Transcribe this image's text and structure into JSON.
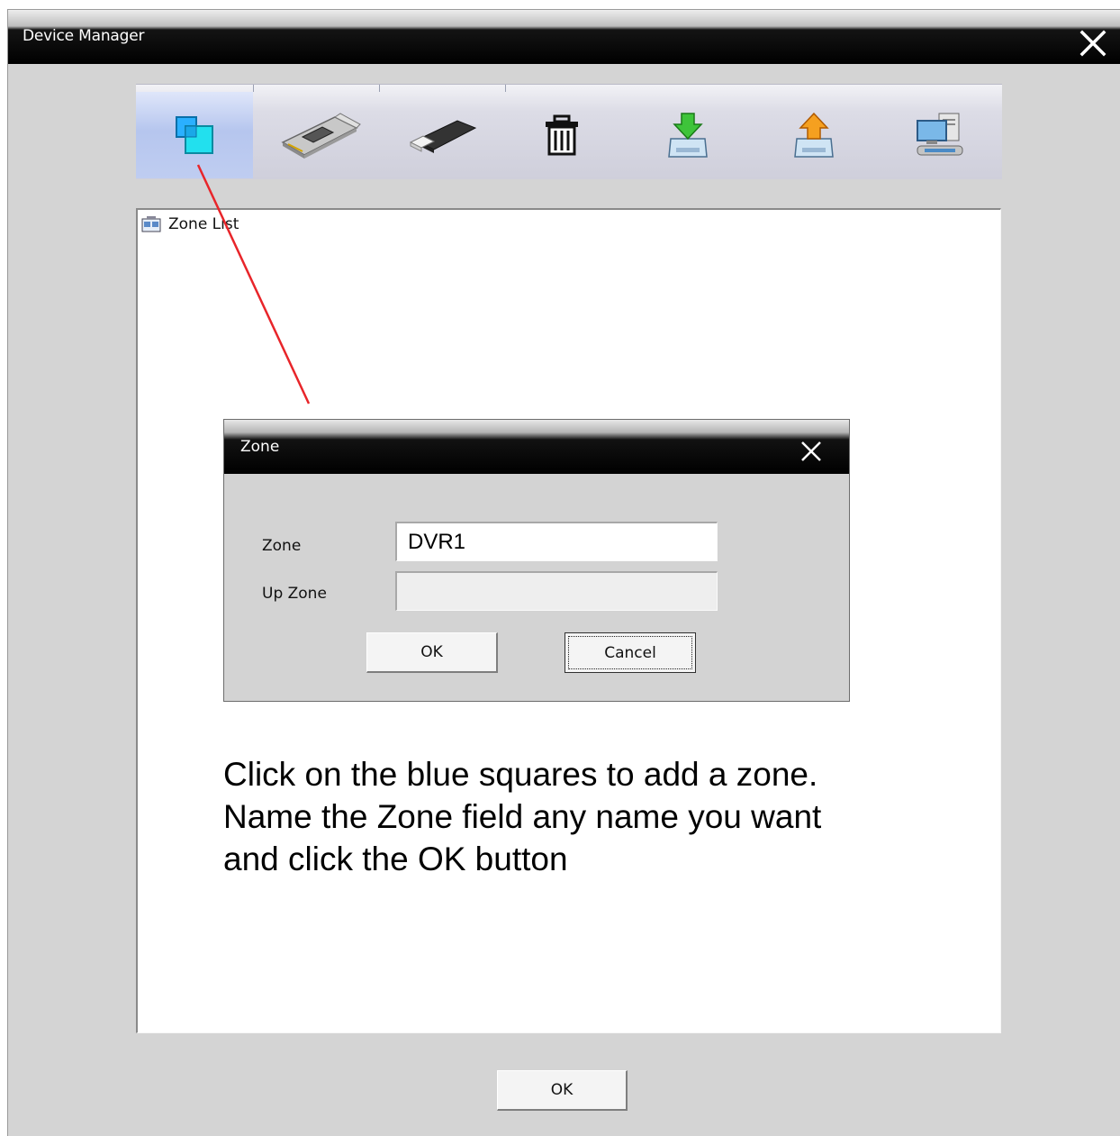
{
  "window": {
    "title": "Device Manager"
  },
  "toolbar": {
    "buttons": [
      {
        "name": "add-zone",
        "icon": "blue-squares-icon",
        "active": true
      },
      {
        "name": "add-card",
        "icon": "pci-card-icon"
      },
      {
        "name": "add-device",
        "icon": "usb-stick-icon"
      },
      {
        "name": "delete",
        "icon": "trash-icon"
      },
      {
        "name": "import",
        "icon": "import-down-arrow-icon"
      },
      {
        "name": "export",
        "icon": "export-up-arrow-icon"
      },
      {
        "name": "network",
        "icon": "network-computers-icon"
      }
    ]
  },
  "tree": {
    "root_label": "Zone List"
  },
  "zone_dialog": {
    "title": "Zone",
    "zone_label": "Zone",
    "zone_value": "DVR1",
    "up_zone_label": "Up Zone",
    "up_zone_value": "",
    "ok_label": "OK",
    "cancel_label": "Cancel"
  },
  "instruction": {
    "lines": [
      "Click on the blue squares to add a zone.",
      "Name the Zone field any name you want",
      "and click the OK button"
    ]
  },
  "footer": {
    "ok_label": "OK"
  },
  "colors": {
    "annotation_line": "#e8252a",
    "zone_icon_blue": "#1fd0e8",
    "window_bg": "#d4d4d4"
  }
}
